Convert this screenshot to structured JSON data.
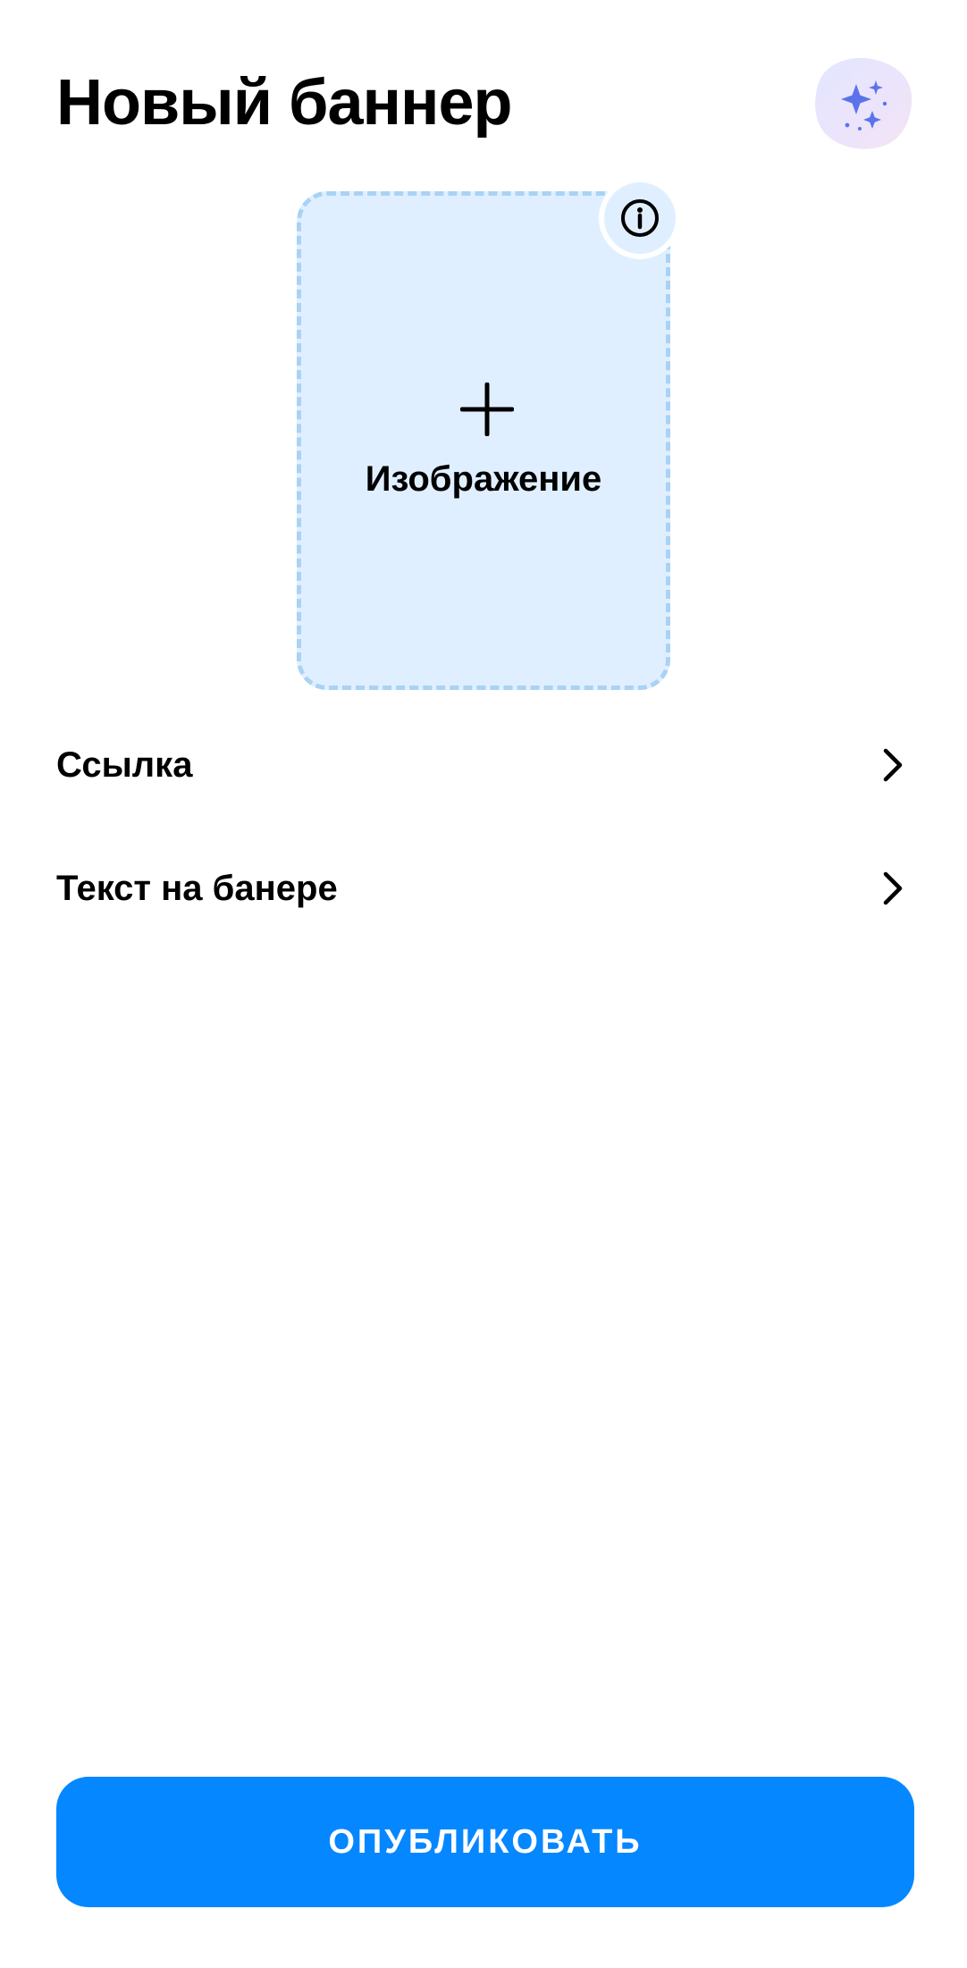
{
  "header": {
    "title": "Новый баннер",
    "ai_button_icon": "sparkles-icon"
  },
  "image_upload": {
    "label": "Изображение",
    "add_icon": "plus-icon",
    "info_icon": "info-icon"
  },
  "menu": {
    "items": [
      {
        "label": "Ссылка",
        "icon": "chevron-right-icon"
      },
      {
        "label": "Текст на банере",
        "icon": "chevron-right-icon"
      }
    ]
  },
  "footer": {
    "publish_label": "ОПУБЛИКОВАТЬ"
  },
  "colors": {
    "accent": "#0587ff",
    "upload_bg": "#e0efff",
    "upload_border": "#a9d2f5",
    "sparkle": "#5b73ea",
    "text": "#000000",
    "background": "#ffffff"
  }
}
